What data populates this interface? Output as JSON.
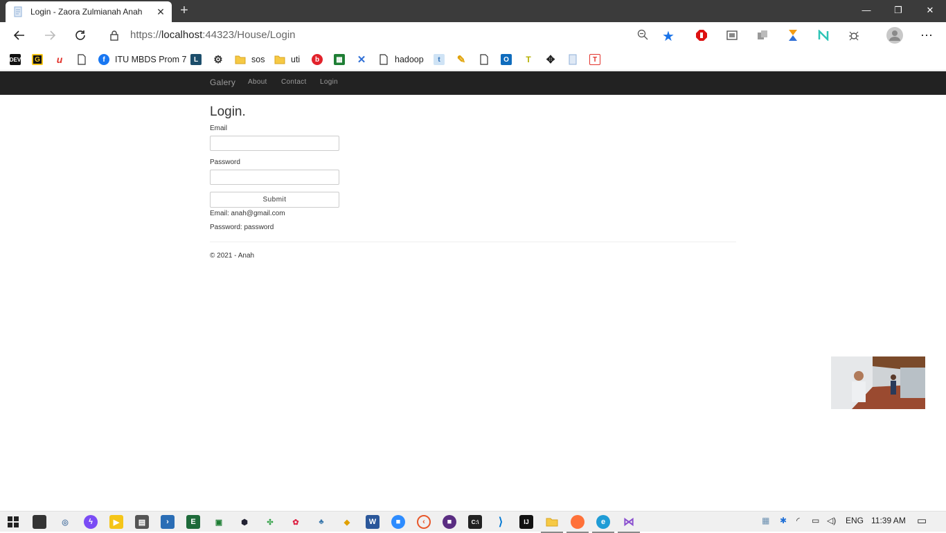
{
  "browser": {
    "tab_title": "Login - Zaora Zulmianah Anah",
    "tab_close": "✕",
    "new_tab": "+",
    "window_controls": {
      "minimize": "—",
      "restore": "❐",
      "close": "✕"
    },
    "url_host": "localhost",
    "url_prefix": "https://",
    "url_rest": ":44323/House/Login",
    "accent_color": "#1a73e8"
  },
  "bookmarks": [
    {
      "label": "",
      "icon": "dev-icon",
      "glyph": "DEV"
    },
    {
      "label": "",
      "icon": "grammarly-icon",
      "glyph": "G"
    },
    {
      "label": "",
      "icon": "u-logo-icon",
      "glyph": "u"
    },
    {
      "label": "",
      "icon": "page-icon",
      "glyph": ""
    },
    {
      "label": "ITU MBDS Prom 7",
      "icon": "facebook-icon",
      "glyph": "f"
    },
    {
      "label": "",
      "icon": "l-logo-icon",
      "glyph": "L"
    },
    {
      "label": "",
      "icon": "gear-icon",
      "glyph": "⚙"
    },
    {
      "label": "sos",
      "icon": "folder-icon",
      "glyph": ""
    },
    {
      "label": "uti",
      "icon": "folder-icon",
      "glyph": ""
    },
    {
      "label": "",
      "icon": "beats-icon",
      "glyph": "b"
    },
    {
      "label": "",
      "icon": "green-app-icon",
      "glyph": "▦"
    },
    {
      "label": "",
      "icon": "x-logo-icon",
      "glyph": "✕"
    },
    {
      "label": "hadoop",
      "icon": "page-icon",
      "glyph": ""
    },
    {
      "label": "",
      "icon": "t-logo-icon",
      "glyph": "t"
    },
    {
      "label": "",
      "icon": "pencil-icon",
      "glyph": "✎"
    },
    {
      "label": "",
      "icon": "page-icon",
      "glyph": ""
    },
    {
      "label": "",
      "icon": "outlook-icon",
      "glyph": "O"
    },
    {
      "label": "",
      "icon": "t-yellow-icon",
      "glyph": "T"
    },
    {
      "label": "",
      "icon": "nodes-icon",
      "glyph": "✥"
    },
    {
      "label": "",
      "icon": "doc-icon",
      "glyph": ""
    },
    {
      "label": "",
      "icon": "t-red-icon",
      "glyph": "T"
    }
  ],
  "site": {
    "brand": "Galery",
    "nav": [
      "About",
      "Contact",
      "Login"
    ],
    "heading": "Login.",
    "email_label": "Email",
    "email_value": "",
    "password_label": "Password",
    "password_value": "",
    "submit_label": "Submit",
    "hint_email": "Email: anah@gmail.com",
    "hint_password": "Password: password",
    "footer": "© 2021 - Anah"
  },
  "taskbar": {
    "language": "ENG",
    "time": "11:39 AM"
  }
}
